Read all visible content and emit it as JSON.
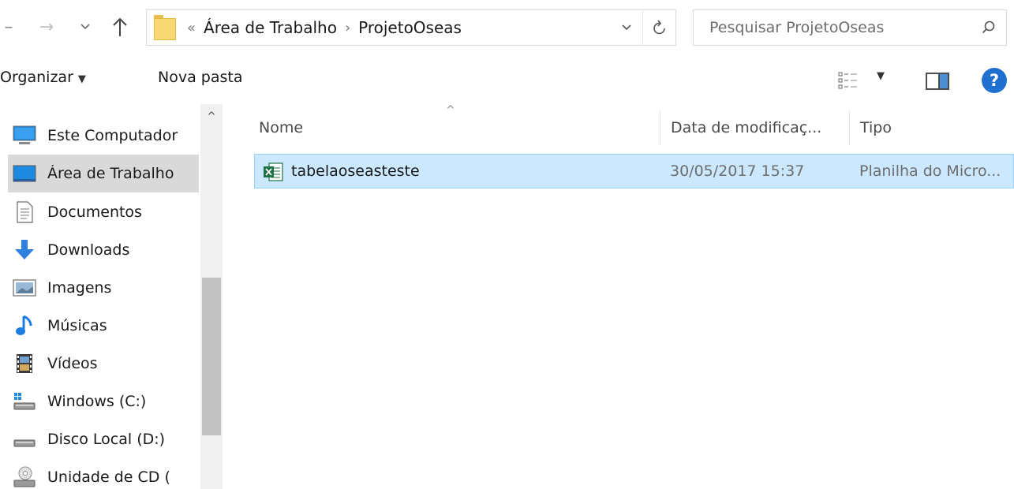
{
  "address_bar": {
    "overflow_glyph": "«",
    "separator": "›",
    "breadcrumbs": [
      "Área de Trabalho",
      "ProjetoOseas"
    ]
  },
  "search": {
    "placeholder": "Pesquisar ProjetoOseas"
  },
  "toolbar": {
    "organize_label": "Organizar",
    "new_folder_label": "Nova pasta",
    "help_label": "?"
  },
  "navigation": {
    "items": [
      {
        "label": "Este Computador",
        "icon": "computer-icon",
        "selected": false
      },
      {
        "label": "Área de Trabalho",
        "icon": "desktop-icon",
        "selected": true
      },
      {
        "label": "Documentos",
        "icon": "documents-icon",
        "selected": false
      },
      {
        "label": "Downloads",
        "icon": "downloads-icon",
        "selected": false
      },
      {
        "label": "Imagens",
        "icon": "pictures-icon",
        "selected": false
      },
      {
        "label": "Músicas",
        "icon": "music-icon",
        "selected": false
      },
      {
        "label": "Vídeos",
        "icon": "videos-icon",
        "selected": false
      },
      {
        "label": "Windows (C:)",
        "icon": "windows-drive-icon",
        "selected": false
      },
      {
        "label": "Disco Local (D:)",
        "icon": "local-disk-icon",
        "selected": false
      },
      {
        "label": "Unidade de CD (",
        "icon": "cd-drive-icon",
        "selected": false
      }
    ]
  },
  "file_list": {
    "columns": {
      "name": "Nome",
      "date": "Data de modificaç...",
      "type": "Tipo"
    },
    "rows": [
      {
        "name": "tabelaoseasteste",
        "date": "30/05/2017 15:37",
        "type": "Planilha do Micro...",
        "icon": "excel-file-icon",
        "selected": true
      }
    ]
  },
  "colors": {
    "selection_bg": "#cce8ff",
    "selection_border": "#99d1ff",
    "nav_selected_bg": "#d9d9d9",
    "help_blue": "#1f6fd1",
    "excel_green": "#1e7145",
    "download_blue": "#2f7fe0"
  }
}
